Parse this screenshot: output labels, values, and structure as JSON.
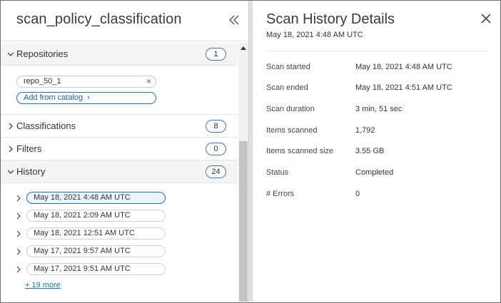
{
  "left_panel": {
    "title": "scan_policy_classification",
    "collapse_icon": "double-chevron-left-icon"
  },
  "sections": {
    "repositories": {
      "label": "Repositories",
      "count": "1",
      "items": [
        {
          "name": "repo_50_1",
          "remove_glyph": "×"
        }
      ],
      "add_label": "Add from catalog",
      "add_glyph": "›"
    },
    "classifications": {
      "label": "Classifications",
      "count": "8"
    },
    "filters": {
      "label": "Filters",
      "count": "0"
    },
    "history": {
      "label": "History",
      "count": "24",
      "entries": [
        {
          "label": "May 18, 2021 4:48 AM   UTC",
          "selected": true
        },
        {
          "label": "May 18, 2021 2:09 AM   UTC",
          "selected": false
        },
        {
          "label": "May 18, 2021 12:51 AM   UTC",
          "selected": false
        },
        {
          "label": "May 17, 2021 9:57 AM   UTC",
          "selected": false
        },
        {
          "label": "May 17, 2021 9:51 AM   UTC",
          "selected": false
        }
      ],
      "more_label": "+ 19 more"
    }
  },
  "details": {
    "title": "Scan History Details",
    "subtitle": "May 18, 2021 4:48 AM   UTC",
    "close_icon": "close-icon",
    "fields": [
      {
        "label": "Scan started",
        "value": "May 18, 2021 4:48 AM   UTC"
      },
      {
        "label": "Scan ended",
        "value": "May 18, 2021 4:51 AM   UTC"
      },
      {
        "label": "Scan duration",
        "value": "3 min, 51 sec"
      },
      {
        "label": "Items scanned",
        "value": "1,792"
      },
      {
        "label": "Items scanned size",
        "value": "3.55 GB"
      },
      {
        "label": "Status",
        "value": "Completed"
      },
      {
        "label": "# Errors",
        "value": "0"
      }
    ]
  },
  "colors": {
    "accent": "#2a6f9b",
    "link": "#1f6fb2",
    "selected_bg": "#eaf5fa"
  }
}
